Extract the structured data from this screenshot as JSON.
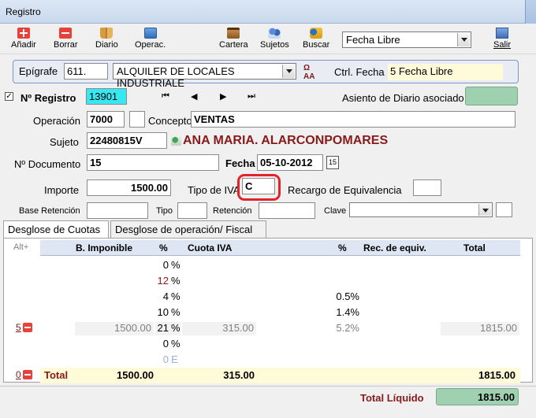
{
  "window": {
    "title": "Registro"
  },
  "toolbar": {
    "add": "Añadir",
    "delete": "Borrar",
    "diary": "Diario",
    "ops": "Operac.",
    "portfolio": "Cartera",
    "subjects": "Sujetos",
    "search": "Buscar",
    "exit": "Salir",
    "mode_select": "Fecha Libre"
  },
  "epigrafe": {
    "label": "Epígrafe",
    "code": "611.",
    "description": "ALQUILER DE LOCALES INDUSTRIALE",
    "ctrl_label": "Ctrl. Fecha",
    "ctrl_value": "5 Fecha Libre"
  },
  "registro": {
    "label": "Nº Registro",
    "value": "13901",
    "asiento_label": "Asiento de Diario asociado"
  },
  "operacion": {
    "label": "Operación",
    "value": "7000",
    "concepto_label": "Concepto",
    "concepto": "VENTAS"
  },
  "sujeto": {
    "label": "Sujeto",
    "value": "22480815V",
    "name": "ANA MARIA. ALARCONPOMARES"
  },
  "documento": {
    "label": "Nº Documento",
    "value": "15",
    "fecha_label": "Fecha",
    "fecha": "05-10-2012",
    "cal": "15"
  },
  "importe": {
    "label": "Importe",
    "value": "1500.00",
    "tipo_iva_label": "Tipo de IVA",
    "tipo_iva": "C",
    "recargo_label": "Recargo de Equivalencia"
  },
  "retencion": {
    "base_label": "Base Retención",
    "tipo_label": "Tipo",
    "ret_label": "Retención",
    "clave_label": "Clave"
  },
  "tabs": [
    "Desglose de Cuotas",
    "Desglose de operación/ Fiscal"
  ],
  "grid": {
    "alt": "Alt+",
    "headers": {
      "base": "B. Imponible",
      "pct": "%",
      "cuota": "Cuota IVA",
      "pct2": "%",
      "rec": "Rec. de equiv.",
      "total": "Total"
    },
    "rows": [
      {
        "base": "",
        "pct": "0",
        "sym": "%",
        "cuota": "",
        "rpct": "",
        "total": ""
      },
      {
        "base": "",
        "pct": "12",
        "sym": "%",
        "cuota": "",
        "rpct": "",
        "total": ""
      },
      {
        "base": "",
        "pct": "4",
        "sym": "%",
        "cuota": "",
        "rpct": "0.5%",
        "total": ""
      },
      {
        "base": "",
        "pct": "10",
        "sym": "%",
        "cuota": "",
        "rpct": "1.4%",
        "total": ""
      },
      {
        "base": "1500.00",
        "pct": "21",
        "sym": "%",
        "cuota": "315.00",
        "rpct": "5.2%",
        "total": "1815.00"
      },
      {
        "base": "",
        "pct": "0",
        "sym": "%",
        "cuota": "",
        "rpct": "",
        "total": ""
      },
      {
        "base": "",
        "pct": "0",
        "sym": "E",
        "cuota": "",
        "rpct": "",
        "total": ""
      }
    ],
    "row_marker": "5",
    "total_marker": "0",
    "total_label": "Total",
    "total_base": "1500.00",
    "total_cuota": "315.00",
    "total_total": "1815.00"
  },
  "footer": {
    "label": "Total Líquido",
    "value": "1815.00"
  },
  "colors": {
    "cyan_field": "#35e8f2",
    "yellow_field": "#fffbd8",
    "green_field": "#9fd1b1",
    "red_highlight": "#e0242a",
    "name_color": "#8a1a1a"
  }
}
